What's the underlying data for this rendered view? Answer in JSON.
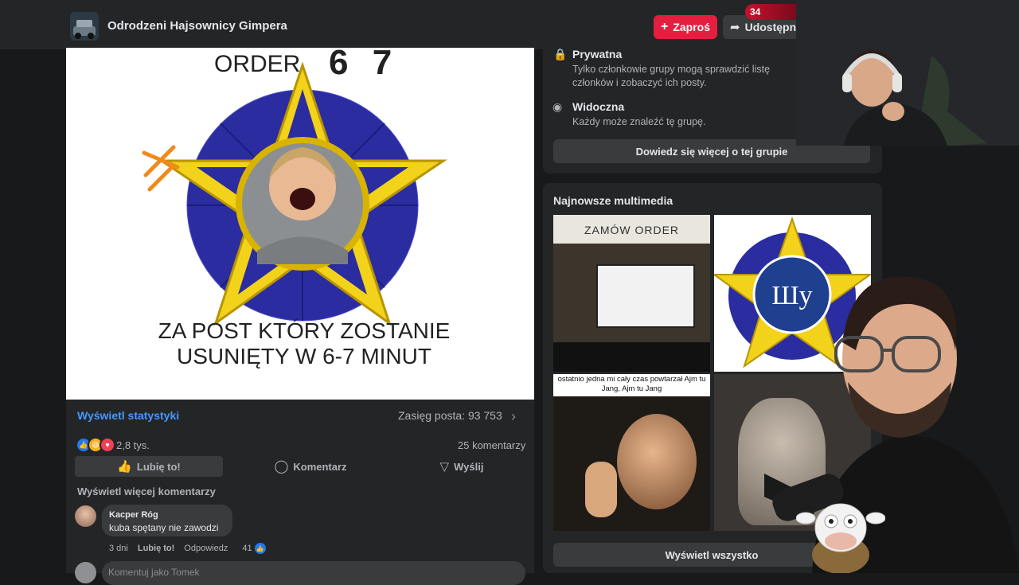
{
  "header": {
    "group_name": "Odrodzeni Hajsownicy Gimpera",
    "invite_label": "Zaproś",
    "share_label": "Udostępnij",
    "notification_count": "34"
  },
  "post": {
    "image_text": {
      "order": "ORDER",
      "number": "6 7",
      "line1": "ZA POST KTÓRY ZOSTANIE",
      "line2": "USUNIĘTY W 6-7 MINUT"
    },
    "stats_link": "Wyświetl statystyki",
    "reach": "Zasięg posta: 93 753",
    "reaction_count": "2,8 tys.",
    "comment_count": "25 komentarzy",
    "actions": {
      "like": "Lubię to!",
      "comment": "Komentarz",
      "send": "Wyślij"
    },
    "more_comments": "Wyświetl więcej komentarzy",
    "comment": {
      "author": "Kacper Róg",
      "text": "kuba spętany nie zawodzi",
      "age": "3 dni",
      "like": "Lubię to!",
      "reply": "Odpowiedz",
      "likes": "41"
    },
    "comment_input_placeholder": "Komentuj jako Tomek"
  },
  "about": {
    "private_title": "Prywatna",
    "private_desc": "Tylko członkowie grupy mogą sprawdzić listę członków i zobaczyć ich posty.",
    "visible_title": "Widoczna",
    "visible_desc": "Każdy może znaleźć tę grupę.",
    "learn_more": "Dowiedz się więcej o tej grupie"
  },
  "media": {
    "title": "Najnowsze multimedia",
    "thumb1_title": "ZAMÓW ORDER",
    "thumb3_caption": "ostatnio jedna mi cały czas powtarzał Ajm tu Jang, Ajm tu Jang",
    "see_all": "Wyświetl wszystko"
  },
  "colors": {
    "accent_blue": "#4599ff",
    "invite_red": "#e41e3f",
    "background": "#18191a",
    "card": "#242526"
  }
}
